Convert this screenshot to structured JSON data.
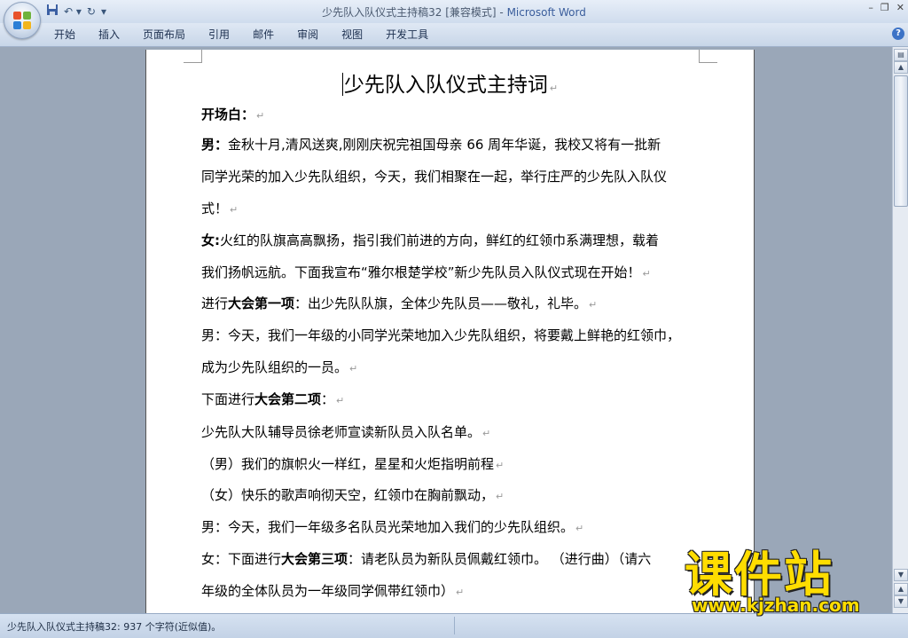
{
  "window": {
    "doc_name": "少先队入队仪式主持稿32 [兼容模式]",
    "separator": " - ",
    "app_name": "Microsoft Word"
  },
  "ribbon": {
    "tabs": [
      "开始",
      "插入",
      "页面布局",
      "引用",
      "邮件",
      "审阅",
      "视图",
      "开发工具"
    ]
  },
  "document": {
    "title": "少先队入队仪式主持词",
    "mark": "↵",
    "lines": [
      {
        "b": "开场白：",
        "t": "",
        "m": true
      },
      {
        "b": "男：",
        "t": "金秋十月,清风送爽,刚刚庆祝完祖国母亲 66 周年华诞，我校又将有一批新",
        "m": false
      },
      {
        "b": "",
        "t": "同学光荣的加入少先队组织，今天，我们相聚在一起，举行庄严的少先队入队仪",
        "m": false
      },
      {
        "b": "",
        "t": "式！",
        "m": true
      },
      {
        "b": "女:",
        "t": "火红的队旗高高飘扬，指引我们前进的方向，鲜红的红领巾系满理想，载着",
        "m": false
      },
      {
        "b": "",
        "t": "我们扬帆远航。下面我宣布“雅尔根楚学校”新少先队员入队仪式现在开始！",
        "m": true
      },
      {
        "b": "",
        "t": "进行",
        "b2": "大会第一项",
        "t2": "：出少先队队旗，全体少先队员——敬礼，礼毕。",
        "m": true
      },
      {
        "b": "",
        "t": "男：今天，我们一年级的小同学光荣地加入少先队组织，将要戴上鲜艳的红领巾，",
        "m": false
      },
      {
        "b": "",
        "t": "成为少先队组织的一员。",
        "m": true
      },
      {
        "b": "",
        "t": "下面进行",
        "b2": "大会第二项",
        "t2": "：",
        "m": true
      },
      {
        "b": "",
        "t": "少先队大队辅导员徐老师宣读新队员入队名单。",
        "m": true
      },
      {
        "b": "",
        "t": "（男）我们的旗帜火一样红，星星和火炬指明前程",
        "m": true
      },
      {
        "b": "",
        "t": "（女）快乐的歌声响彻天空，红领巾在胸前飘动，",
        "m": true
      },
      {
        "b": "",
        "t": "男：今天，我们一年级多名队员光荣地加入我们的少先队组织。",
        "m": true
      },
      {
        "b": "",
        "t": "女：下面进行",
        "b2": "大会第三项",
        "t2": "：请老队员为新队员佩戴红领巾。   （进行曲）（请六",
        "m": false
      },
      {
        "b": "",
        "t": "年级的全体队员为一年级同学佩带红领巾）",
        "m": true
      }
    ]
  },
  "status": {
    "text": "少先队入队仪式主持稿32: 937 个字符(近似值)。"
  },
  "watermark": {
    "title": "课件站",
    "url": "www.kjzhan.com"
  },
  "colors": {
    "accent": "#3a5d9c",
    "watermark": "#ffdd00"
  }
}
